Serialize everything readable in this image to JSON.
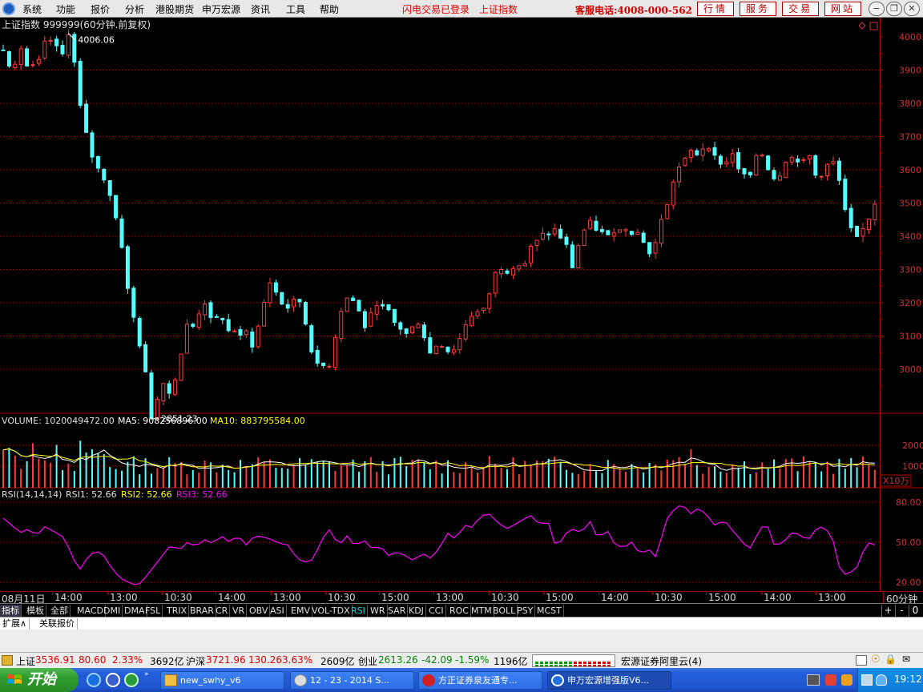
{
  "menu": {
    "items": [
      "系统",
      "功能",
      "报价",
      "分析",
      "港股期货",
      "申万宏源",
      "资讯",
      "工具",
      "帮助"
    ],
    "status_login": "闪电交易已登录",
    "status_index": "上证指数",
    "hotline": "客服电话:4008-000-562",
    "buttons": [
      "行情",
      "服务",
      "交易",
      "网站"
    ]
  },
  "chart": {
    "title": "上证指数 999999(60分钟.前复权)",
    "high_label": "4006.06",
    "low_label": "2851.23",
    "price_ticks": [
      "4000",
      "3900",
      "3800",
      "3700",
      "3600",
      "3500",
      "3400",
      "3300",
      "3200",
      "3100",
      "3000"
    ],
    "volume_line": {
      "label": "VOLUME:",
      "value": "1020049472.00",
      "ma5_label": "MA5:",
      "ma5": "908256896.00",
      "ma10_label": "MA10:",
      "ma10": "883795584.00"
    },
    "volume_ticks": [
      "20000",
      "10000"
    ],
    "volume_unit": "X10万",
    "rsi_line": {
      "label": "RSI(14,14,14)",
      "rsi1_label": "RSI1:",
      "rsi1": "52.66",
      "rsi2_label": "RSI2:",
      "rsi2": "52.66",
      "rsi3_label": "RSI3:",
      "rsi3": "52.66"
    },
    "rsi_ticks": [
      "80.00",
      "50.00",
      "20.00"
    ],
    "period": "60分钟",
    "colors": {
      "up": "#ff3c3c",
      "down": "#54ffff",
      "frame": "#b00000",
      "ma5": "#ffffff",
      "ma10": "#ffff00",
      "rsi": "#ff00ff"
    }
  },
  "chart_data": {
    "type": "candlestick",
    "title": "上证指数 999999(60分钟.前复权)",
    "ylim": [
      2800,
      4050
    ],
    "max_marked": 4006.06,
    "min_marked": 2851.23,
    "path": [
      3960,
      3890,
      3980,
      3900,
      3930,
      3980,
      3990,
      3950,
      4006,
      3830,
      3700,
      3610,
      3580,
      3500,
      3400,
      3230,
      3080,
      3000,
      2851,
      2970,
      2920,
      3010,
      3150,
      3130,
      3200,
      3150,
      3160,
      3120,
      3100,
      3120,
      3060,
      3200,
      3260,
      3210,
      3180,
      3230,
      3140,
      3040,
      3010,
      3020,
      3160,
      3210,
      3200,
      3120,
      3180,
      3200,
      3170,
      3130,
      3110,
      3140,
      3120,
      3050,
      3070,
      3040,
      3050,
      3120,
      3160,
      3180,
      3230,
      3320,
      3290,
      3300,
      3310,
      3360,
      3420,
      3400,
      3430,
      3380,
      3300,
      3400,
      3450,
      3420,
      3390,
      3420,
      3440,
      3400,
      3410,
      3330,
      3400,
      3480,
      3580,
      3640,
      3660,
      3630,
      3680,
      3640,
      3620,
      3650,
      3600,
      3580,
      3660,
      3620,
      3580,
      3600,
      3650,
      3620,
      3660,
      3580,
      3600,
      3630,
      3540,
      3420,
      3390,
      3440,
      3500
    ],
    "x_labels": [
      "08月11日",
      "14:00",
      "13:00",
      "10:30",
      "14:00",
      "13:00",
      "10:30",
      "15:00",
      "13:00",
      "10:30",
      "15:00",
      "14:00",
      "10:30",
      "15:00",
      "14:00",
      "13:00"
    ],
    "volume": {
      "unit": "X10万",
      "ticks": [
        20000,
        10000
      ],
      "value": 1020049472.0,
      "ma5": 908256896.0,
      "ma10": 883795584.0
    },
    "rsi": {
      "ticks": [
        80,
        50,
        20
      ],
      "rsi1": 52.66,
      "rsi2": 52.66,
      "rsi3": 52.66,
      "path": [
        68,
        63,
        57,
        60,
        55,
        62,
        58,
        55,
        44,
        28,
        38,
        44,
        40,
        30,
        23,
        20,
        17,
        24,
        32,
        40,
        48,
        44,
        50,
        47,
        52,
        49,
        55,
        50,
        55,
        48,
        55,
        54,
        52,
        49,
        48,
        38,
        35,
        37,
        52,
        60,
        47,
        55,
        47,
        52,
        45,
        47,
        40,
        43,
        40,
        36,
        42,
        38,
        45,
        57,
        52,
        63,
        61,
        70,
        71,
        65,
        60,
        63,
        67,
        70,
        63,
        66,
        45,
        56,
        60,
        57,
        66,
        52,
        60,
        48,
        46,
        50,
        41,
        45,
        38,
        66,
        74,
        79,
        71,
        76,
        70,
        62,
        67,
        59,
        52,
        44,
        56,
        66,
        48,
        49,
        57,
        56,
        51,
        60,
        62,
        52,
        25,
        27,
        32,
        50,
        48
      ]
    }
  },
  "tabs": {
    "items": [
      "指标",
      "模板",
      "全部",
      "MACD",
      "DMI",
      "DMA",
      "FSL",
      "TRIX",
      "BRAR",
      "CR",
      "VR",
      "OBV",
      "ASI",
      "EMV",
      "VOL-TDX",
      "RSI",
      "WR",
      "SAR",
      "KDJ",
      "CCI",
      "ROC",
      "MTM",
      "BOLL",
      "PSY",
      "MCST"
    ],
    "active": "RSI",
    "controls": [
      "+",
      "-",
      "0"
    ]
  },
  "subtabs": [
    "扩展∧",
    "关联报价"
  ],
  "statusbar": {
    "sh_label": "上证",
    "sh_value": "3536.91",
    "sh_change": "80.60",
    "sh_pct": "2.33%",
    "sh_amount": "3692亿",
    "hs_label": "沪深",
    "hs_value": "3721.96",
    "hs_change": "130.26",
    "hs_pct": "3.63%",
    "hs_amount": "2609亿",
    "cy_label": "创业",
    "cy_value": "2613.26",
    "cy_change": "-42.09",
    "cy_pct": "-1.59%",
    "cy_amount": "1196亿",
    "server": "宏源证券阿里云(4)"
  },
  "taskbar": {
    "start": "开始",
    "windows": [
      "new_swhy_v6",
      "12 - 23 - 2014 S...",
      "方正证券泉友通专...",
      "申万宏源增强版V6..."
    ],
    "clock": "19:12"
  }
}
